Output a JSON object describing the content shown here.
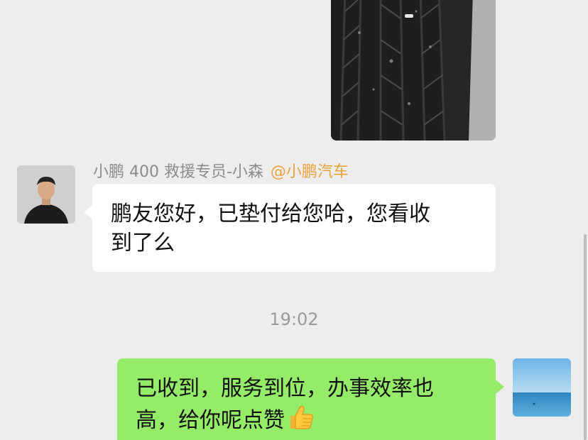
{
  "messages": {
    "tire_photo": {
      "icon": "tire-photo"
    },
    "agent_message": {
      "sender_name": "小鹏 400 救援专员-小森",
      "sender_tag": "@小鹏汽车",
      "line1": "鹏友您好，已垫付给您哈，您看收",
      "line2": "到了么"
    },
    "timestamp": "19:02",
    "my_message": {
      "line1": "已收到，服务到位，办事效率也",
      "line2": "高，给你呢点赞",
      "emoji_icon": "thumbs-up-icon"
    }
  },
  "colors": {
    "background": "#ededed",
    "incoming_bubble": "#ffffff",
    "outgoing_bubble": "#95ec69",
    "sender_tag": "#e8a33c"
  }
}
